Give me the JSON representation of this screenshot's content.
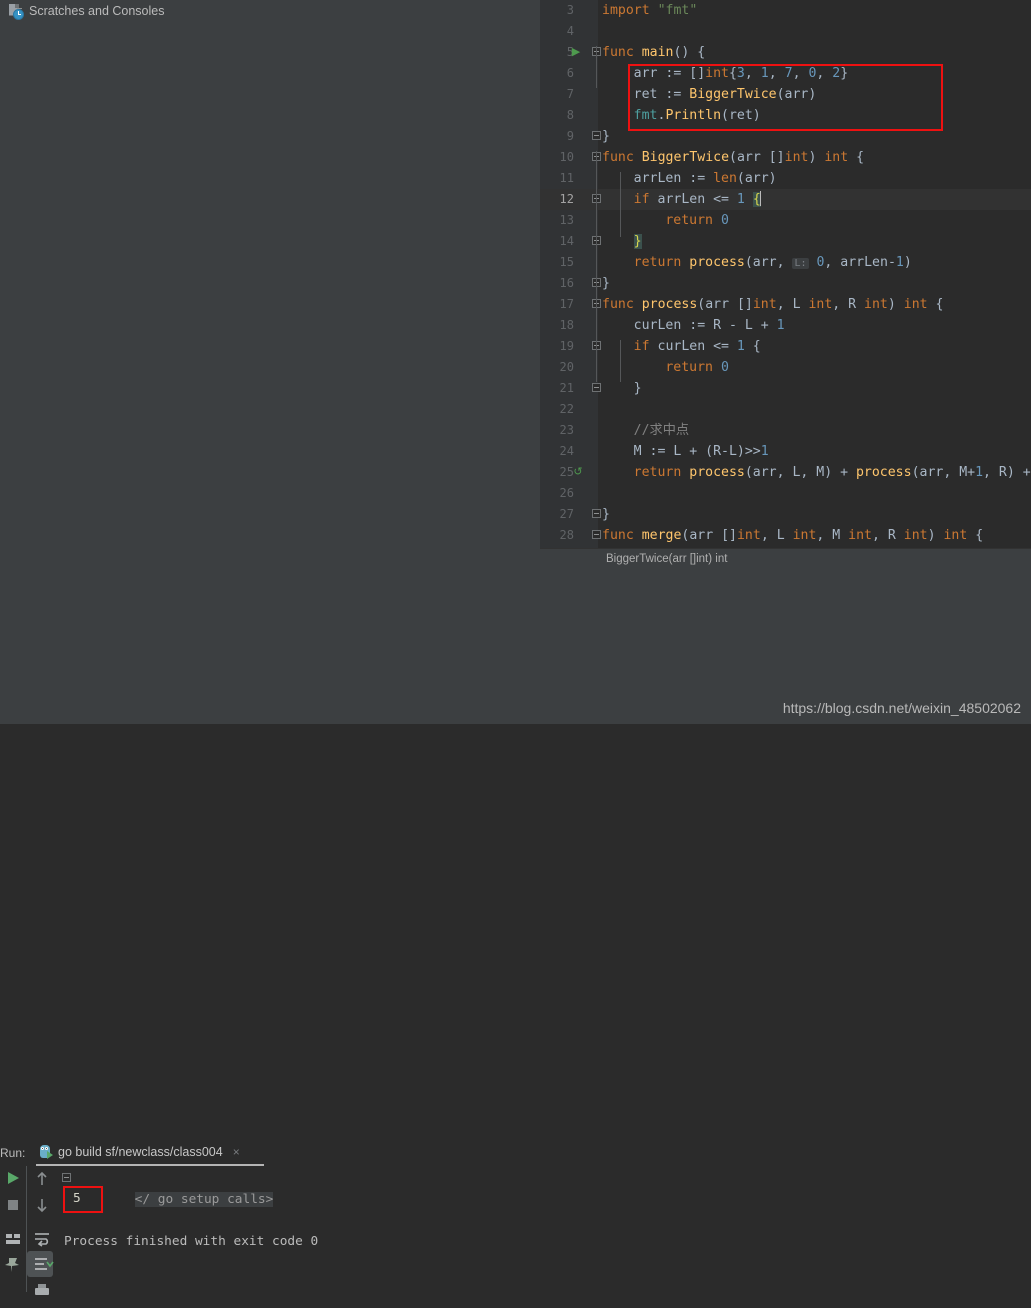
{
  "project_tree": {
    "item_label": "Scratches and Consoles",
    "icon": "scratch-file-icon"
  },
  "editor": {
    "breadcrumb": "BiggerTwice(arr []int) int",
    "lines": [
      {
        "num": "3",
        "indent": 1,
        "tokens": [
          {
            "t": "import ",
            "c": "k"
          },
          {
            "t": "\"fmt\"",
            "c": "s"
          }
        ]
      },
      {
        "num": "4",
        "indent": 1,
        "tokens": []
      },
      {
        "num": "5",
        "indent": 1,
        "run": true,
        "fold": true,
        "tokens": [
          {
            "t": "func ",
            "c": "k"
          },
          {
            "t": "main",
            "c": "f"
          },
          {
            "t": "() {",
            "c": "t"
          }
        ]
      },
      {
        "num": "6",
        "indent": 2,
        "tokens": [
          {
            "t": "arr := []",
            "c": "t"
          },
          {
            "t": "int",
            "c": "k"
          },
          {
            "t": "{",
            "c": "t"
          },
          {
            "t": "3",
            "c": "n"
          },
          {
            "t": ", ",
            "c": "t"
          },
          {
            "t": "1",
            "c": "n"
          },
          {
            "t": ", ",
            "c": "t"
          },
          {
            "t": "7",
            "c": "n"
          },
          {
            "t": ", ",
            "c": "t"
          },
          {
            "t": "0",
            "c": "n"
          },
          {
            "t": ", ",
            "c": "t"
          },
          {
            "t": "2",
            "c": "n"
          },
          {
            "t": "}",
            "c": "t"
          }
        ]
      },
      {
        "num": "7",
        "indent": 2,
        "tokens": [
          {
            "t": "ret := ",
            "c": "t"
          },
          {
            "t": "BiggerTwice",
            "c": "f"
          },
          {
            "t": "(arr)",
            "c": "t"
          }
        ]
      },
      {
        "num": "8",
        "indent": 2,
        "tokens": [
          {
            "t": "fmt",
            "c": "pkg"
          },
          {
            "t": ".",
            "c": "t"
          },
          {
            "t": "Println",
            "c": "f"
          },
          {
            "t": "(ret)",
            "c": "t"
          }
        ]
      },
      {
        "num": "9",
        "indent": 1,
        "foldend": true,
        "tokens": [
          {
            "t": "}",
            "c": "t"
          }
        ]
      },
      {
        "num": "10",
        "indent": 1,
        "fold": true,
        "tokens": [
          {
            "t": "func ",
            "c": "k"
          },
          {
            "t": "BiggerTwice",
            "c": "f"
          },
          {
            "t": "(arr []",
            "c": "t"
          },
          {
            "t": "int",
            "c": "k"
          },
          {
            "t": ") ",
            "c": "t"
          },
          {
            "t": "int",
            "c": "k"
          },
          {
            "t": " {",
            "c": "t"
          }
        ]
      },
      {
        "num": "11",
        "indent": 2,
        "tokens": [
          {
            "t": "arrLen := ",
            "c": "t"
          },
          {
            "t": "len",
            "c": "k"
          },
          {
            "t": "(arr)",
            "c": "t"
          }
        ]
      },
      {
        "num": "12",
        "indent": 2,
        "selected": true,
        "fold": true,
        "tokens": [
          {
            "t": "if ",
            "c": "k"
          },
          {
            "t": "arrLen <= ",
            "c": "t"
          },
          {
            "t": "1",
            "c": "n"
          },
          {
            "t": " ",
            "c": "t"
          },
          {
            "t": "{",
            "c": "brc"
          },
          {
            "t": "|caret|",
            "c": "caret"
          }
        ]
      },
      {
        "num": "13",
        "indent": 3,
        "tokens": [
          {
            "t": "return ",
            "c": "k"
          },
          {
            "t": "0",
            "c": "n"
          }
        ]
      },
      {
        "num": "14",
        "indent": 2,
        "foldend": true,
        "tokens": [
          {
            "t": "}",
            "c": "brc"
          }
        ]
      },
      {
        "num": "15",
        "indent": 2,
        "tokens": [
          {
            "t": "return ",
            "c": "k"
          },
          {
            "t": "process",
            "c": "f"
          },
          {
            "t": "(arr, ",
            "c": "t"
          },
          {
            "t": "L:",
            "c": "hint"
          },
          {
            "t": " ",
            "c": "t"
          },
          {
            "t": "0",
            "c": "n"
          },
          {
            "t": ", arrLen-",
            "c": "t"
          },
          {
            "t": "1",
            "c": "n"
          },
          {
            "t": ")",
            "c": "t"
          }
        ]
      },
      {
        "num": "16",
        "indent": 1,
        "foldend": true,
        "tokens": [
          {
            "t": "}",
            "c": "t"
          }
        ]
      },
      {
        "num": "17",
        "indent": 1,
        "fold": true,
        "tokens": [
          {
            "t": "func ",
            "c": "k"
          },
          {
            "t": "process",
            "c": "f"
          },
          {
            "t": "(arr []",
            "c": "t"
          },
          {
            "t": "int",
            "c": "k"
          },
          {
            "t": ", L ",
            "c": "t"
          },
          {
            "t": "int",
            "c": "k"
          },
          {
            "t": ", R ",
            "c": "t"
          },
          {
            "t": "int",
            "c": "k"
          },
          {
            "t": ") ",
            "c": "t"
          },
          {
            "t": "int",
            "c": "k"
          },
          {
            "t": " {",
            "c": "t"
          }
        ]
      },
      {
        "num": "18",
        "indent": 2,
        "tokens": [
          {
            "t": "curLen := R - L + ",
            "c": "t"
          },
          {
            "t": "1",
            "c": "n"
          }
        ]
      },
      {
        "num": "19",
        "indent": 2,
        "fold": true,
        "tokens": [
          {
            "t": "if ",
            "c": "k"
          },
          {
            "t": "curLen <= ",
            "c": "t"
          },
          {
            "t": "1",
            "c": "n"
          },
          {
            "t": " {",
            "c": "t"
          }
        ]
      },
      {
        "num": "20",
        "indent": 3,
        "tokens": [
          {
            "t": "return ",
            "c": "k"
          },
          {
            "t": "0",
            "c": "n"
          }
        ]
      },
      {
        "num": "21",
        "indent": 2,
        "foldend": true,
        "tokens": [
          {
            "t": "}",
            "c": "t"
          }
        ]
      },
      {
        "num": "22",
        "indent": 2,
        "tokens": []
      },
      {
        "num": "23",
        "indent": 2,
        "tokens": [
          {
            "t": "//求中点",
            "c": "c"
          }
        ]
      },
      {
        "num": "24",
        "indent": 2,
        "tokens": [
          {
            "t": "M := L + (R-L)>>",
            "c": "t"
          },
          {
            "t": "1",
            "c": "n"
          }
        ]
      },
      {
        "num": "25",
        "indent": 2,
        "recursion": true,
        "tokens": [
          {
            "t": "return ",
            "c": "k"
          },
          {
            "t": "process",
            "c": "f"
          },
          {
            "t": "(arr, L, M) + ",
            "c": "t"
          },
          {
            "t": "process",
            "c": "f"
          },
          {
            "t": "(arr, M+",
            "c": "t"
          },
          {
            "t": "1",
            "c": "n"
          },
          {
            "t": ", R) +",
            "c": "t"
          }
        ]
      },
      {
        "num": "26",
        "indent": 2,
        "tokens": []
      },
      {
        "num": "27",
        "indent": 1,
        "foldend": true,
        "tokens": [
          {
            "t": "}",
            "c": "t"
          }
        ]
      },
      {
        "num": "28",
        "indent": 1,
        "fold": true,
        "tokens": [
          {
            "t": "func ",
            "c": "k"
          },
          {
            "t": "merge",
            "c": "f"
          },
          {
            "t": "(arr []",
            "c": "t"
          },
          {
            "t": "int",
            "c": "k"
          },
          {
            "t": ", L ",
            "c": "t"
          },
          {
            "t": "int",
            "c": "k"
          },
          {
            "t": ", M ",
            "c": "t"
          },
          {
            "t": "int",
            "c": "k"
          },
          {
            "t": ", R ",
            "c": "t"
          },
          {
            "t": "int",
            "c": "k"
          },
          {
            "t": ") ",
            "c": "t"
          },
          {
            "t": "int",
            "c": "k"
          },
          {
            "t": " {",
            "c": "t"
          }
        ]
      }
    ],
    "highlight_box": {
      "label": "code-annotation-box",
      "color": "#ee1111"
    }
  },
  "run_panel": {
    "label": "Run:",
    "tab": {
      "title": "go build sf/newclass/class004",
      "close": "×",
      "icon": "go-gopher-run-icon"
    },
    "toolbar_left": [
      {
        "name": "rerun-button",
        "icon": "play-icon"
      },
      {
        "name": "stop-button",
        "icon": "stop-icon"
      },
      {
        "name": "layout-button",
        "icon": "layout-icon"
      },
      {
        "name": "pin-tab-button",
        "icon": "pin-icon"
      }
    ],
    "toolbar_right": [
      {
        "name": "up-stack-button",
        "icon": "arrow-up-icon"
      },
      {
        "name": "down-stack-button",
        "icon": "arrow-down-icon"
      },
      {
        "name": "soft-wrap-button",
        "icon": "wrap-icon"
      },
      {
        "name": "scroll-to-end-button",
        "icon": "scroll-end-icon",
        "selected": true
      },
      {
        "name": "print-button",
        "icon": "printer-icon"
      }
    ],
    "console": {
      "folded_line": "</ go setup calls>",
      "output_value": "5",
      "exit_line": "Process finished with exit code 0",
      "output_box_color": "#ee1111"
    }
  },
  "watermark": "https://blog.csdn.net/weixin_48502062"
}
